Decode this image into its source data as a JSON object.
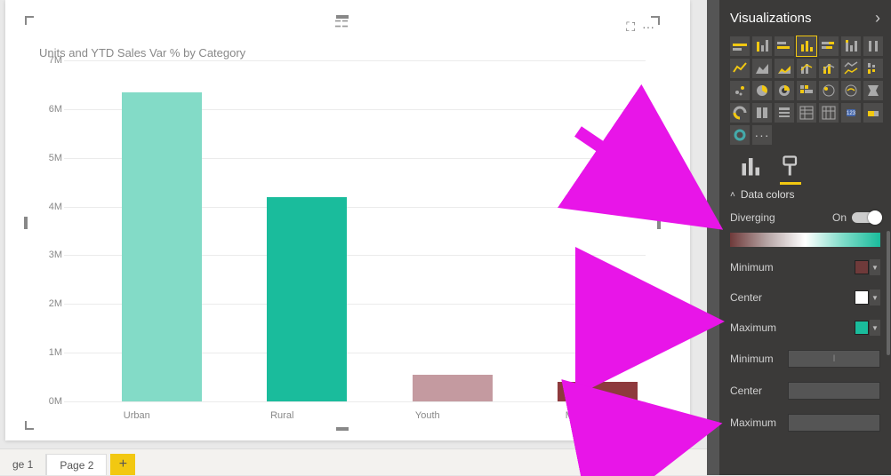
{
  "canvas": {
    "chart_title": "Units and YTD Sales Var % by Category",
    "focus_icon": "⛶",
    "more_icon": "···"
  },
  "chart_data": {
    "type": "bar",
    "title": "Units and YTD Sales Var % by Category",
    "categories": [
      "Urban",
      "Rural",
      "Youth",
      "Mix"
    ],
    "values": [
      6350000,
      4200000,
      550000,
      400000
    ],
    "colors": [
      "#83dbc7",
      "#1abc9c",
      "#c49aa0",
      "#8e3a3d"
    ],
    "ylabel": "",
    "xlabel": "",
    "ylim": [
      0,
      7000000
    ],
    "ytick_labels": [
      "0M",
      "1M",
      "2M",
      "3M",
      "4M",
      "5M",
      "6M",
      "7M"
    ]
  },
  "page_tabs": {
    "items": [
      "ge 1",
      "Page 2"
    ],
    "active_index": 1,
    "add_label": "+"
  },
  "panel": {
    "title": "Visualizations",
    "expand_icon": "›",
    "gallery_count": 27,
    "gallery_selected_index": 3,
    "tabs": {
      "fields_icon": "bar-chart-icon",
      "format_icon": "paint-roller-icon",
      "active": 1
    },
    "section": {
      "name": "Data colors",
      "diverging_label": "Diverging",
      "diverging_state": "On",
      "min_label": "Minimum",
      "center_label": "Center",
      "max_label": "Maximum",
      "min_color": "#6f3a3a",
      "center_color": "#ffffff",
      "max_color": "#1abc9c",
      "min_value": "",
      "center_value": "",
      "max_value": ""
    }
  }
}
